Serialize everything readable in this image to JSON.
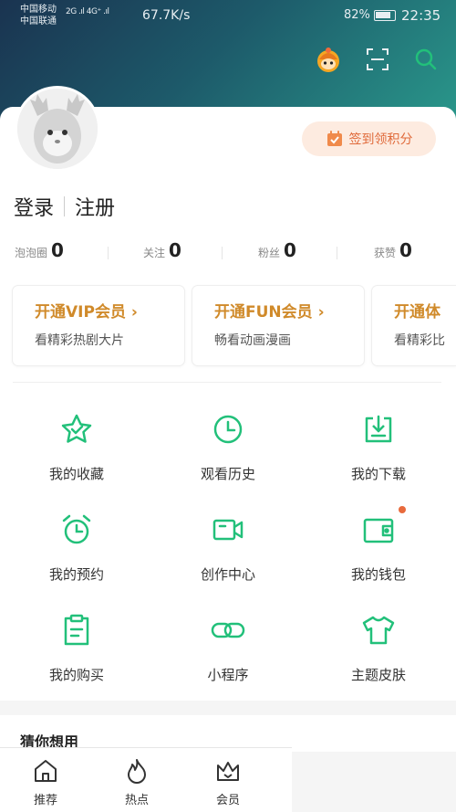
{
  "status_bar": {
    "carrier_1": "中国移动",
    "carrier_2": "中国联通",
    "signal_text": "2G .ıl 4G⁺ .ıl",
    "net_speed": "67.7K/s",
    "battery_percent": "82%",
    "time": "22:35"
  },
  "header": {
    "icons": [
      "mascot-avatar-icon",
      "scan-icon",
      "search-icon"
    ]
  },
  "profile": {
    "signin_label": "签到领积分",
    "login_label": "登录",
    "register_label": "注册"
  },
  "stats": [
    {
      "label": "泡泡圈",
      "value": "0"
    },
    {
      "label": "关注",
      "value": "0"
    },
    {
      "label": "粉丝",
      "value": "0"
    },
    {
      "label": "获赞",
      "value": "0"
    }
  ],
  "vip_cards": [
    {
      "title": "开通VIP会员 ›",
      "subtitle": "看精彩热剧大片"
    },
    {
      "title": "开通FUN会员 ›",
      "subtitle": "畅看动画漫画"
    },
    {
      "title": "开通体",
      "subtitle": "看精彩比"
    }
  ],
  "grid": [
    {
      "label": "我的收藏",
      "icon": "star-icon"
    },
    {
      "label": "观看历史",
      "icon": "clock-icon"
    },
    {
      "label": "我的下载",
      "icon": "download-icon"
    },
    {
      "label": "我的预约",
      "icon": "alarm-clock-icon"
    },
    {
      "label": "创作中心",
      "icon": "video-camera-icon"
    },
    {
      "label": "我的钱包",
      "icon": "wallet-icon"
    },
    {
      "label": "我的购买",
      "icon": "clipboard-icon"
    },
    {
      "label": "小程序",
      "icon": "link-icon"
    },
    {
      "label": "主题皮肤",
      "icon": "tshirt-icon"
    }
  ],
  "guess_section": {
    "title": "猜你想用"
  },
  "bottom_nav": [
    {
      "label": "推荐",
      "icon": "home-icon"
    },
    {
      "label": "热点",
      "icon": "flame-icon"
    },
    {
      "label": "会员",
      "icon": "crown-icon"
    }
  ],
  "colors": {
    "accent_green": "#22c07a",
    "vip_gold": "#d08a2a",
    "signin_orange": "#e06a3a"
  }
}
